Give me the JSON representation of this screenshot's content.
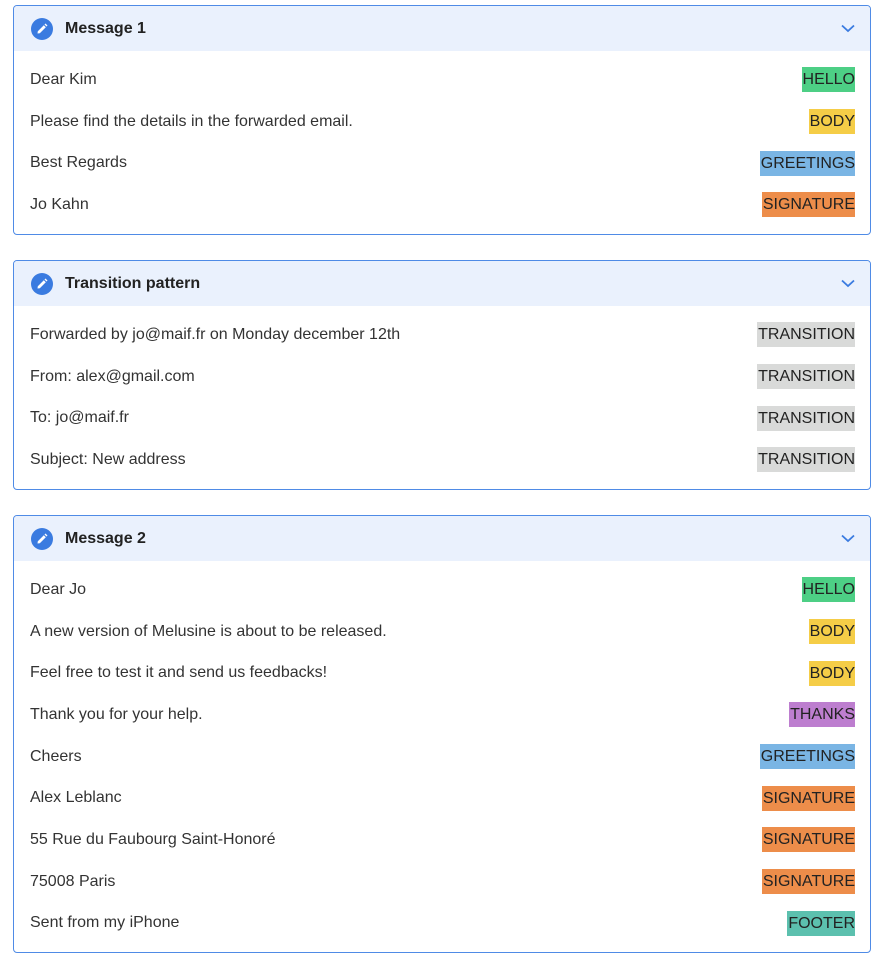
{
  "colors": {
    "HELLO": "#4dcf85",
    "BODY": "#f5cd47",
    "GREETINGS": "#7ab5e4",
    "SIGNATURE": "#ed8d4a",
    "TRANSITION": "#d9dad9",
    "THANKS": "#bd7ecf",
    "FOOTER": "#5cc0ae",
    "panel_border": "#4f8be6",
    "header_bg": "#eaf1fd",
    "icon_bg": "#3a7be0"
  },
  "panels": [
    {
      "title": "Message 1",
      "rows": [
        {
          "text": "Dear Kim",
          "tag": "HELLO"
        },
        {
          "text": "Please find the details in the forwarded email.",
          "tag": "BODY"
        },
        {
          "text": "Best Regards",
          "tag": "GREETINGS"
        },
        {
          "text": "Jo Kahn",
          "tag": "SIGNATURE"
        }
      ]
    },
    {
      "title": "Transition pattern",
      "rows": [
        {
          "text": "Forwarded by jo@maif.fr on Monday december 12th",
          "tag": "TRANSITION"
        },
        {
          "text": "From: alex@gmail.com",
          "tag": "TRANSITION"
        },
        {
          "text": "To: jo@maif.fr",
          "tag": "TRANSITION"
        },
        {
          "text": "Subject: New address",
          "tag": "TRANSITION"
        }
      ]
    },
    {
      "title": "Message 2",
      "rows": [
        {
          "text": "Dear Jo",
          "tag": "HELLO"
        },
        {
          "text": "A new version of Melusine is about to be released.",
          "tag": "BODY"
        },
        {
          "text": "Feel free to test it and send us feedbacks!",
          "tag": "BODY"
        },
        {
          "text": "Thank you for your help.",
          "tag": "THANKS"
        },
        {
          "text": "Cheers",
          "tag": "GREETINGS"
        },
        {
          "text": "Alex Leblanc",
          "tag": "SIGNATURE"
        },
        {
          "text": "55 Rue du Faubourg Saint-Honoré",
          "tag": "SIGNATURE"
        },
        {
          "text": "75008 Paris",
          "tag": "SIGNATURE"
        },
        {
          "text": "Sent from my iPhone",
          "tag": "FOOTER"
        }
      ]
    }
  ]
}
